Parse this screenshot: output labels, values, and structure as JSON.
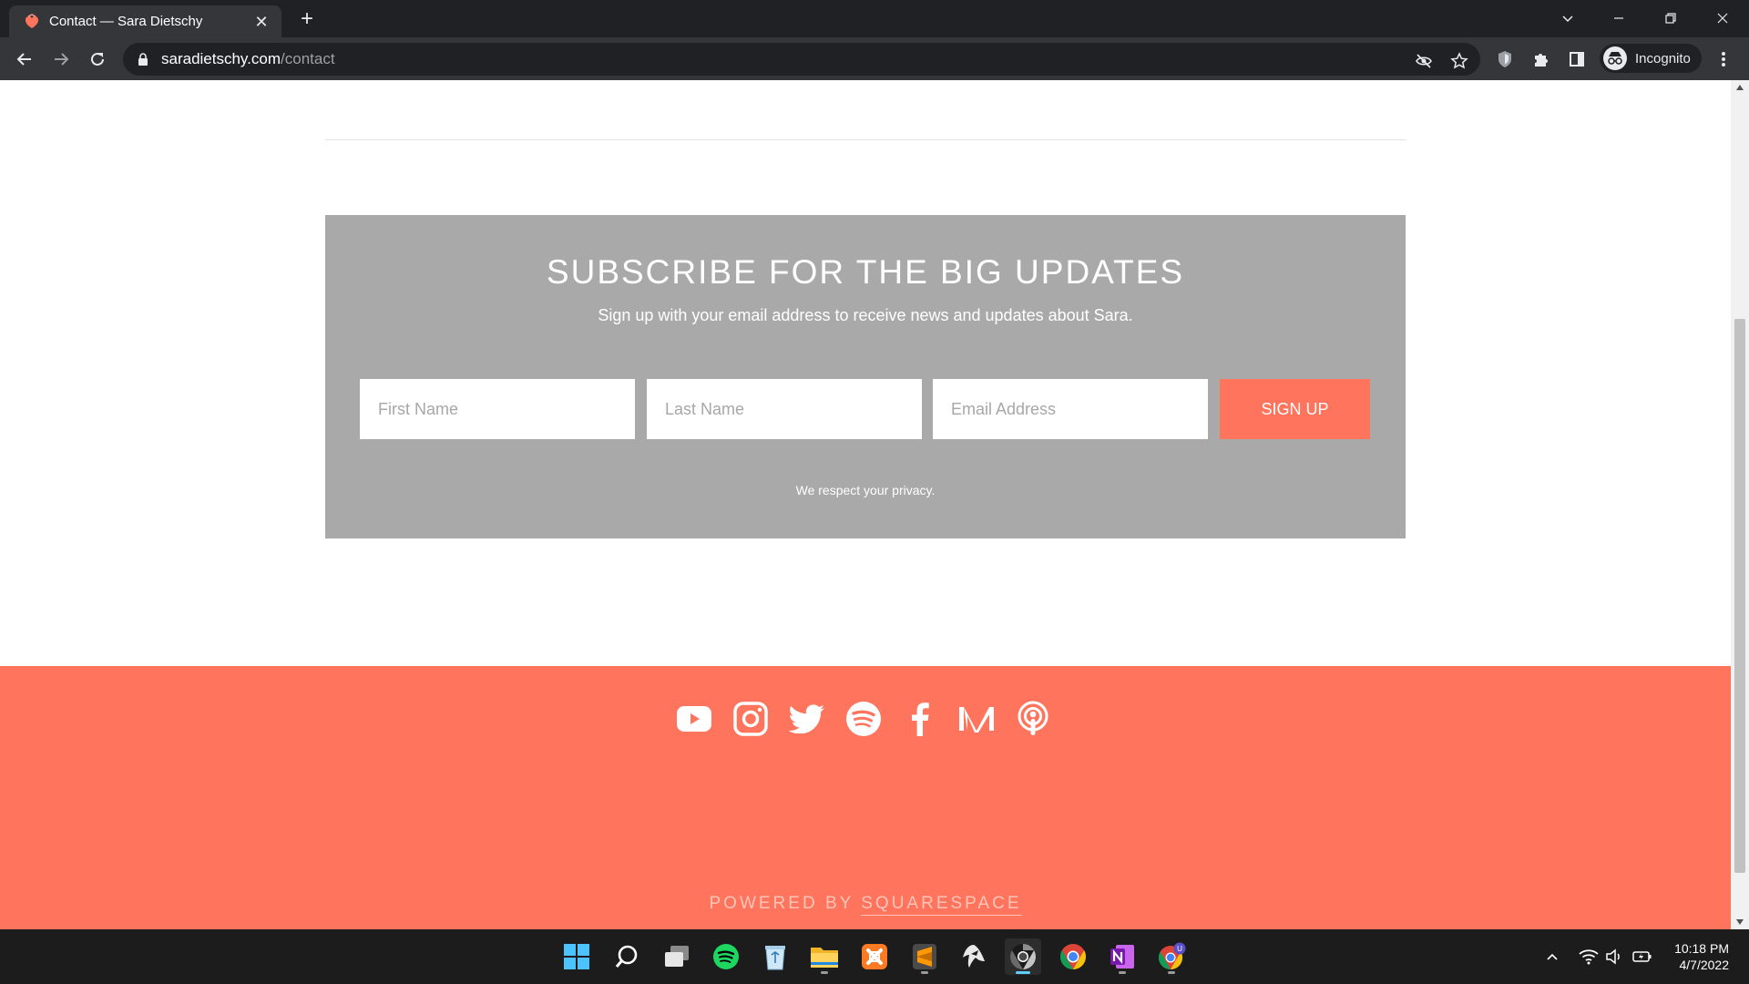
{
  "browser": {
    "tab_title": "Contact — Sara Dietschy",
    "url_host": "saradietschy.com",
    "url_path": "/contact",
    "profile_label": "Incognito"
  },
  "newsletter": {
    "title": "SUBSCRIBE FOR THE BIG UPDATES",
    "description": "Sign up with your email address to receive news and updates about Sara.",
    "first_name_placeholder": "First Name",
    "last_name_placeholder": "Last Name",
    "email_placeholder": "Email Address",
    "signup_label": "SIGN UP",
    "privacy_note": "We respect your privacy."
  },
  "footer": {
    "social_icons": [
      "youtube-icon",
      "instagram-icon",
      "twitter-icon",
      "spotify-icon",
      "facebook-icon",
      "medium-icon",
      "podcast-icon"
    ],
    "powered_prefix": "POWERED BY",
    "powered_brand": "SQUARESPACE"
  },
  "taskbar": {
    "apps": [
      "windows-start-icon",
      "search-icon",
      "task-view-icon",
      "spotify-icon",
      "recycle-bin-icon",
      "file-explorer-icon",
      "xampp-icon",
      "sublime-text-icon",
      "inkscape-icon",
      "chrome-dev-icon",
      "chrome-icon",
      "onenote-icon",
      "chrome-canary-icon"
    ],
    "time": "10:18 PM",
    "date": "4/7/2022"
  },
  "colors": {
    "accent": "#ff745c",
    "newsletter_bg": "#a9a9a9",
    "browser_dark": "#202124",
    "browser_toolbar": "#35363a",
    "taskbar_bg": "#1c1c1c"
  }
}
